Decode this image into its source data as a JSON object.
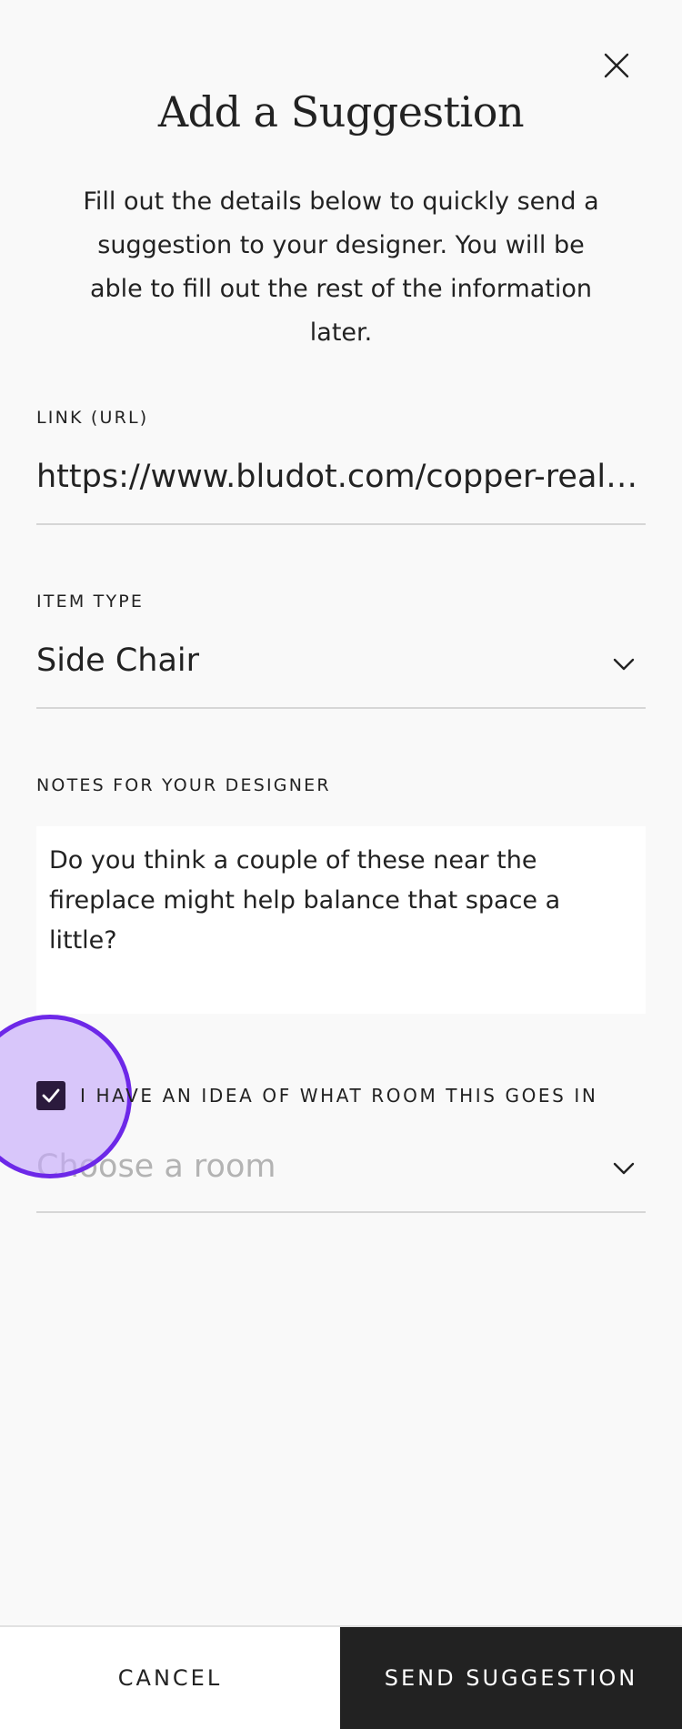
{
  "modal": {
    "title": "Add a Suggestion",
    "subtitle": "Fill out the details below to quickly send a suggestion to your designer. You will be able to fill out the rest of the information later.",
    "close_icon": "close-icon"
  },
  "link_field": {
    "label": "LINK (URL)",
    "value": "https://www.bludot.com/copper-real-good-side-chair"
  },
  "item_type_field": {
    "label": "ITEM TYPE",
    "value": "Side Chair",
    "icon": "chevron-down-icon"
  },
  "notes_field": {
    "label": "NOTES FOR YOUR DESIGNER",
    "value": "Do you think a couple of these near the fireplace might help balance that space a little?"
  },
  "room_checkbox": {
    "label": "I HAVE AN IDEA OF WHAT ROOM THIS GOES IN",
    "checked": true,
    "icon": "checkmark-icon"
  },
  "room_field": {
    "placeholder": "Choose a room",
    "icon": "chevron-down-icon"
  },
  "footer": {
    "cancel_label": "CANCEL",
    "send_label": "SEND SUGGESTION"
  },
  "colors": {
    "background": "#f9f9f9",
    "checkbox": "#2b1a3d",
    "primary_button": "#222222",
    "touch_ring": "#6d28e8",
    "touch_fill": "#c6aafa"
  }
}
